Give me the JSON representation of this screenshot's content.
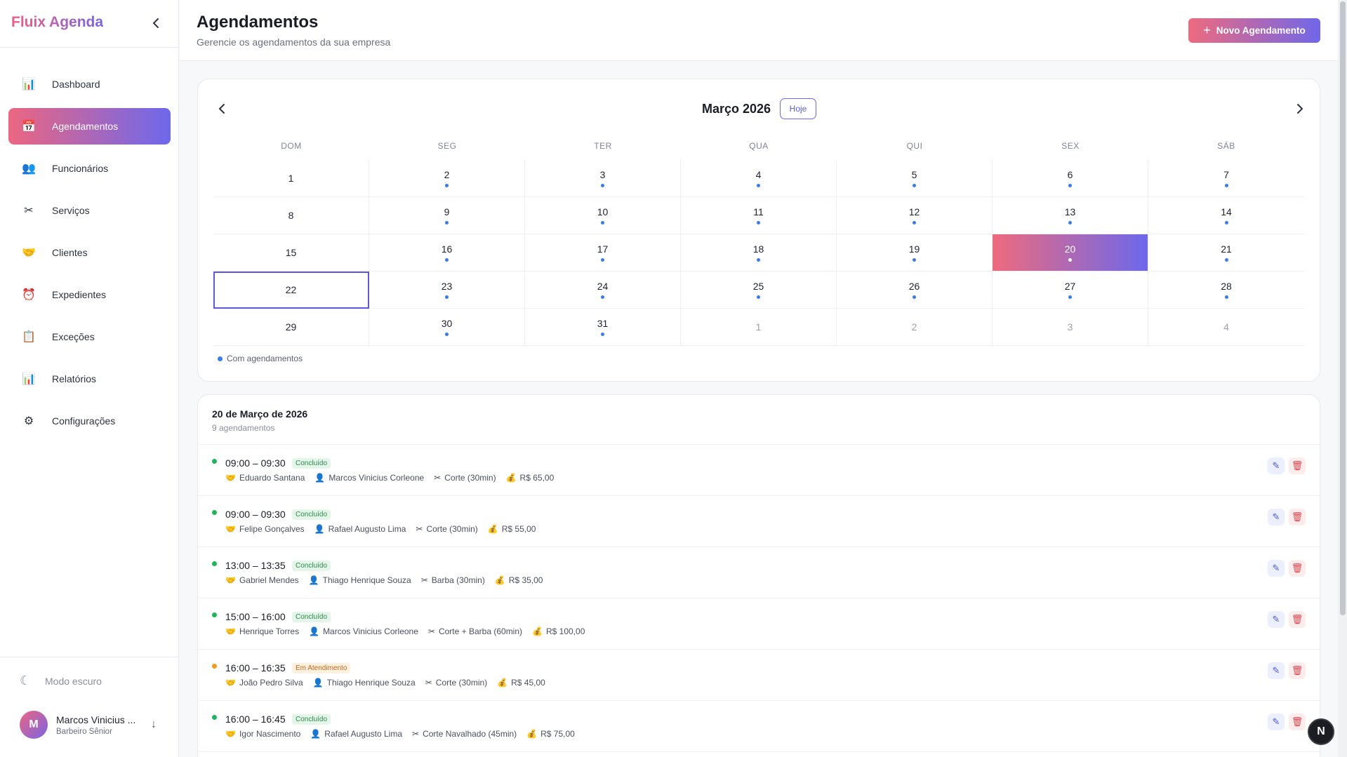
{
  "app": {
    "brand": "Fluix Agenda"
  },
  "sidebar": {
    "items": [
      {
        "label": "Dashboard",
        "icon": "bar-chart-icon",
        "glyph": "📊",
        "active": false
      },
      {
        "label": "Agendamentos",
        "icon": "calendar-icon",
        "glyph": "📅",
        "active": true
      },
      {
        "label": "Funcionários",
        "icon": "people-icon",
        "glyph": "👥",
        "active": false
      },
      {
        "label": "Serviços",
        "icon": "scissors-icon",
        "glyph": "✂",
        "active": false
      },
      {
        "label": "Clientes",
        "icon": "handshake-icon",
        "glyph": "🤝",
        "active": false
      },
      {
        "label": "Expedientes",
        "icon": "alarm-clock-icon",
        "glyph": "⏰",
        "active": false
      },
      {
        "label": "Exceções",
        "icon": "clipboard-icon",
        "glyph": "📋",
        "active": false
      },
      {
        "label": "Relatórios",
        "icon": "report-chart-icon",
        "glyph": "📊",
        "active": false
      },
      {
        "label": "Configurações",
        "icon": "gear-icon",
        "glyph": "⚙",
        "active": false
      }
    ],
    "dark_mode_label": "Modo escuro",
    "user": {
      "initial": "M",
      "name": "Marcos Vinicius ...",
      "role": "Barbeiro Sênior"
    }
  },
  "header": {
    "title": "Agendamentos",
    "subtitle": "Gerencie os agendamentos da sua empresa",
    "new_button": "Novo Agendamento"
  },
  "calendar": {
    "month_label": "Março 2026",
    "today_button": "Hoje",
    "weekdays": [
      "DOM",
      "SEG",
      "TER",
      "QUA",
      "QUI",
      "SEX",
      "SÁB"
    ],
    "days": [
      {
        "n": "1",
        "dot": false,
        "other": false
      },
      {
        "n": "2",
        "dot": true,
        "other": false
      },
      {
        "n": "3",
        "dot": true,
        "other": false
      },
      {
        "n": "4",
        "dot": true,
        "other": false
      },
      {
        "n": "5",
        "dot": true,
        "other": false
      },
      {
        "n": "6",
        "dot": true,
        "other": false
      },
      {
        "n": "7",
        "dot": true,
        "other": false
      },
      {
        "n": "8",
        "dot": false,
        "other": false
      },
      {
        "n": "9",
        "dot": true,
        "other": false
      },
      {
        "n": "10",
        "dot": true,
        "other": false
      },
      {
        "n": "11",
        "dot": true,
        "other": false
      },
      {
        "n": "12",
        "dot": true,
        "other": false
      },
      {
        "n": "13",
        "dot": true,
        "other": false
      },
      {
        "n": "14",
        "dot": true,
        "other": false
      },
      {
        "n": "15",
        "dot": false,
        "other": false
      },
      {
        "n": "16",
        "dot": true,
        "other": false
      },
      {
        "n": "17",
        "dot": true,
        "other": false
      },
      {
        "n": "18",
        "dot": true,
        "other": false
      },
      {
        "n": "19",
        "dot": true,
        "other": false
      },
      {
        "n": "20",
        "dot": true,
        "other": false,
        "selected": true
      },
      {
        "n": "21",
        "dot": true,
        "other": false
      },
      {
        "n": "22",
        "dot": false,
        "other": false,
        "today": true
      },
      {
        "n": "23",
        "dot": true,
        "other": false
      },
      {
        "n": "24",
        "dot": true,
        "other": false
      },
      {
        "n": "25",
        "dot": true,
        "other": false
      },
      {
        "n": "26",
        "dot": true,
        "other": false
      },
      {
        "n": "27",
        "dot": true,
        "other": false
      },
      {
        "n": "28",
        "dot": true,
        "other": false
      },
      {
        "n": "29",
        "dot": false,
        "other": false
      },
      {
        "n": "30",
        "dot": true,
        "other": false
      },
      {
        "n": "31",
        "dot": true,
        "other": false
      },
      {
        "n": "1",
        "dot": false,
        "other": true
      },
      {
        "n": "2",
        "dot": false,
        "other": true
      },
      {
        "n": "3",
        "dot": false,
        "other": true
      },
      {
        "n": "4",
        "dot": false,
        "other": true
      }
    ],
    "legend": "Com agendamentos",
    "colors": {
      "dot": "#3b7bea",
      "accent_start": "#ee6a7e",
      "accent_end": "#6d68ec"
    }
  },
  "appointments": {
    "date_label": "20 de Março de 2026",
    "count_label": "9 agendamentos",
    "items": [
      {
        "time": "09:00 – 09:30",
        "status": "Concluído",
        "status_type": "done",
        "dot_color": "#22b45a",
        "client": "Eduardo Santana",
        "staff": "Marcos Vinicius Corleone",
        "service": "Corte (30min)",
        "price": "R$ 65,00"
      },
      {
        "time": "09:00 – 09:30",
        "status": "Concluído",
        "status_type": "done",
        "dot_color": "#22b45a",
        "client": "Felipe Gonçalves",
        "staff": "Rafael Augusto Lima",
        "service": "Corte (30min)",
        "price": "R$ 55,00"
      },
      {
        "time": "13:00 – 13:35",
        "status": "Concluído",
        "status_type": "done",
        "dot_color": "#22b45a",
        "client": "Gabriel Mendes",
        "staff": "Thiago Henrique Souza",
        "service": "Barba (30min)",
        "price": "R$ 35,00"
      },
      {
        "time": "15:00 – 16:00",
        "status": "Concluído",
        "status_type": "done",
        "dot_color": "#22b45a",
        "client": "Henrique Torres",
        "staff": "Marcos Vinicius Corleone",
        "service": "Corte + Barba (60min)",
        "price": "R$ 100,00"
      },
      {
        "time": "16:00 – 16:35",
        "status": "Em Atendimento",
        "status_type": "attending",
        "dot_color": "#f09a1a",
        "client": "João Pedro Silva",
        "staff": "Thiago Henrique Souza",
        "service": "Corte (30min)",
        "price": "R$ 45,00"
      },
      {
        "time": "16:00 – 16:45",
        "status": "Concluído",
        "status_type": "done",
        "dot_color": "#22b45a",
        "client": "Igor Nascimento",
        "staff": "Rafael Augusto Lima",
        "service": "Corte Navalhado (45min)",
        "price": "R$ 75,00"
      }
    ],
    "icons": {
      "client": "🤝",
      "staff": "👤",
      "service": "✂",
      "price": "💰",
      "edit": "✎",
      "delete": "🗑"
    }
  },
  "floating_button": {
    "label": "N"
  }
}
